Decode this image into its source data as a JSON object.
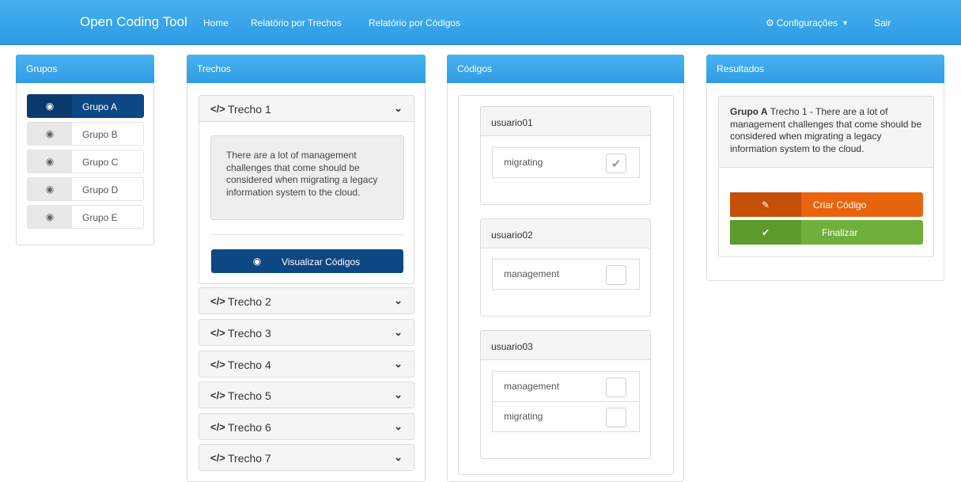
{
  "navbar": {
    "brand": "Open Coding Tool",
    "links": [
      "Home",
      "Relatório por Trechos",
      "Relatório por Códigos"
    ],
    "settings": "Configurações",
    "logout": "Sair"
  },
  "grupos": {
    "title": "Grupos",
    "items": [
      "Grupo A",
      "Grupo B",
      "Grupo C",
      "Grupo D",
      "Grupo E"
    ],
    "active_index": 0
  },
  "trechos": {
    "title": "Trechos",
    "items": [
      "Trecho 1",
      "Trecho 2",
      "Trecho 3",
      "Trecho 4",
      "Trecho 5",
      "Trecho 6",
      "Trecho 7"
    ],
    "expanded_text": "There are a lot of management challenges that come should be considered when migrating a legacy information system to the cloud.",
    "view_button": "Visualizar Códigos"
  },
  "codigos": {
    "title": "Códigos",
    "users": [
      {
        "name": "usuario01",
        "codes": [
          {
            "label": "migrating",
            "checked": true
          }
        ]
      },
      {
        "name": "usuario02",
        "codes": [
          {
            "label": "management",
            "checked": false
          }
        ]
      },
      {
        "name": "usuario03",
        "codes": [
          {
            "label": "management",
            "checked": false
          },
          {
            "label": "migrating",
            "checked": false
          }
        ]
      }
    ]
  },
  "resultados": {
    "title": "Resultados",
    "group": "Grupo A",
    "summary": "Trecho 1 - There are a lot of management challenges that come should be considered when migrating a legacy information system to the cloud.",
    "create_button": "Criar Código",
    "finish_button": "Finalizar"
  },
  "colors": {
    "navbar": "#2d9ae4",
    "primary_dark": "#0e4884",
    "orange": "#e8640f",
    "green": "#6fb03a"
  },
  "icons": {
    "settings": "gear-icon",
    "eye": "eye-icon",
    "code": "code-icon",
    "chevron": "chevron-down-icon",
    "check": "check-icon",
    "edit": "edit-icon"
  }
}
